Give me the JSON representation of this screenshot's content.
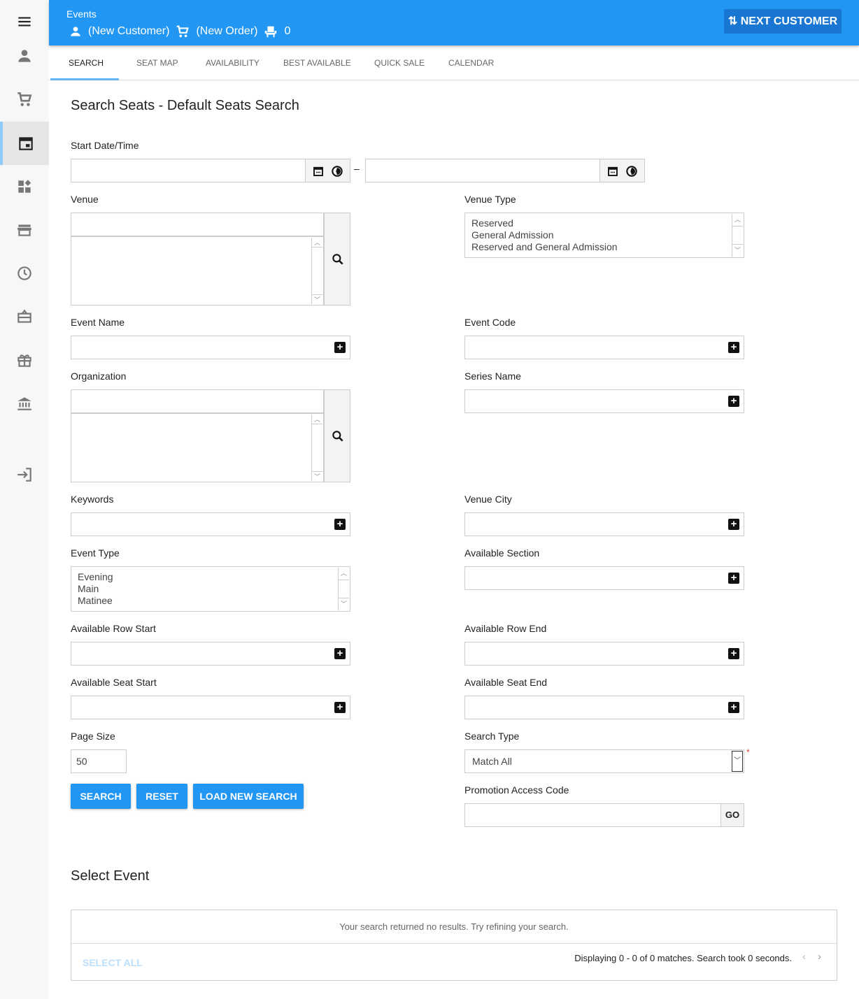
{
  "header": {
    "module": "Events",
    "customer": "(New Customer)",
    "order": "(New Order)",
    "seats": "0",
    "next_customer": "NEXT CUSTOMER"
  },
  "sidebar": {
    "items": [
      "menu-icon",
      "person-icon",
      "cart-icon",
      "calendar-icon",
      "dashboard-icon",
      "store-icon",
      "clock-icon",
      "ticket-icon",
      "gift-icon",
      "bank-icon",
      "exit-icon"
    ],
    "active": "calendar-icon"
  },
  "tabs": [
    "SEARCH",
    "SEAT MAP",
    "AVAILABILITY",
    "BEST AVAILABLE",
    "QUICK SALE",
    "CALENDAR"
  ],
  "form": {
    "title": "Search Seats - Default Seats Search",
    "start_date_label": "Start Date/Time",
    "date_separator": "–",
    "venue_label": "Venue",
    "venue_type_label": "Venue Type",
    "venue_type_options": [
      "Reserved",
      "General Admission",
      "Reserved and General Admission"
    ],
    "event_name_label": "Event Name",
    "event_code_label": "Event Code",
    "organization_label": "Organization",
    "series_name_label": "Series Name",
    "keywords_label": "Keywords",
    "venue_city_label": "Venue City",
    "event_type_label": "Event Type",
    "event_type_options": [
      "Evening",
      "Main",
      "Matinee"
    ],
    "available_section_label": "Available Section",
    "row_start_label": "Available Row Start",
    "row_end_label": "Available Row End",
    "seat_start_label": "Available Seat Start",
    "seat_end_label": "Available Seat End",
    "page_size_label": "Page Size",
    "page_size_value": "50",
    "search_type_label": "Search Type",
    "search_type_value": "Match All",
    "required_mark": "*",
    "promo_label": "Promotion Access Code",
    "go_label": "GO",
    "search_button": "SEARCH",
    "reset_button": "RESET",
    "load_button": "LOAD NEW SEARCH"
  },
  "results": {
    "title": "Select Event",
    "empty": "Your search returned no results. Try refining your search.",
    "select_all": "SELECT ALL",
    "status": "Displaying 0 - 0 of 0 matches. Search took 0 seconds."
  },
  "colors": {
    "primary": "#2196f3",
    "required": "#e53935"
  }
}
